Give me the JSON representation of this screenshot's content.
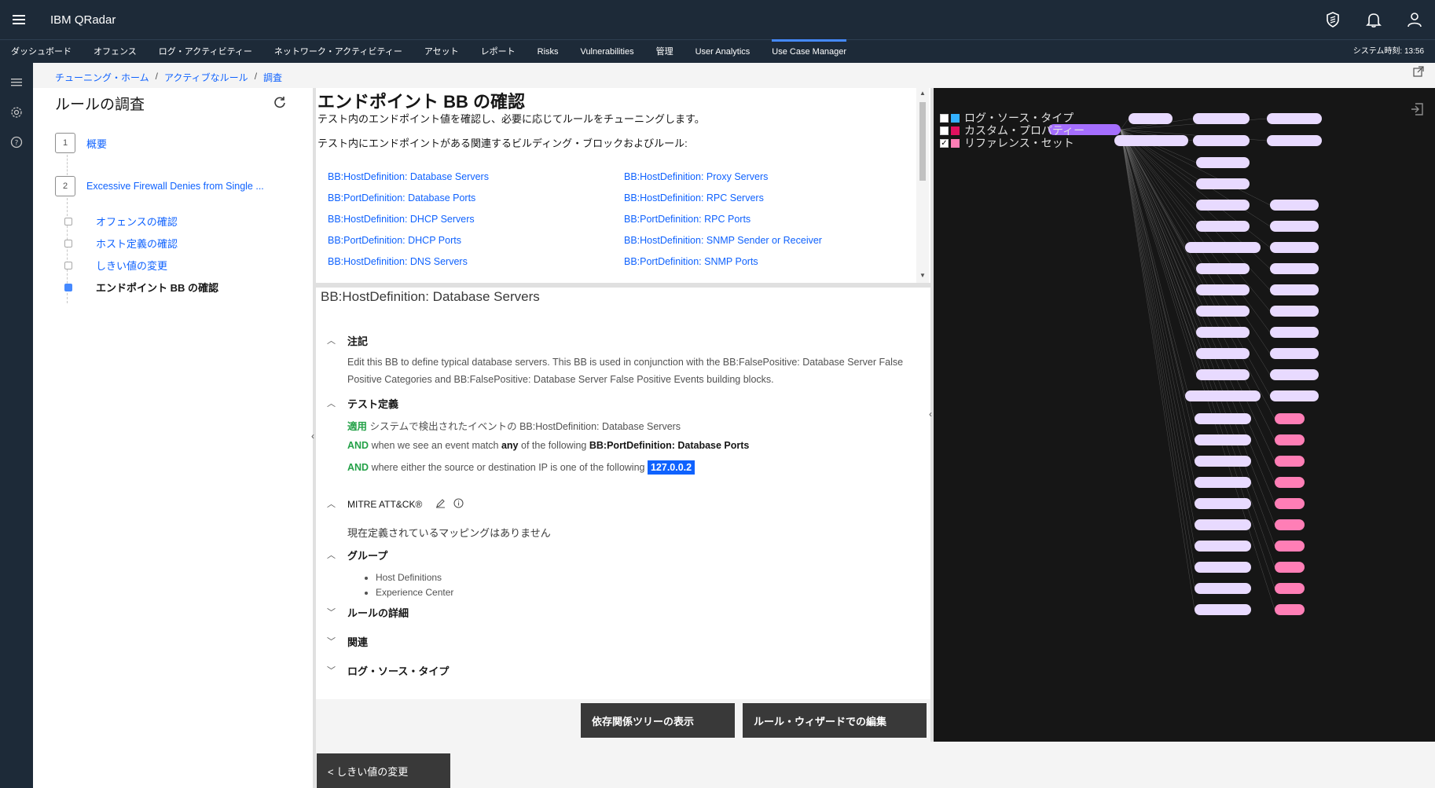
{
  "header": {
    "brand": "IBM QRadar"
  },
  "nav": {
    "items": [
      "ダッシュボード",
      "オフェンス",
      "ログ・アクティビティー",
      "ネットワーク・アクティビティー",
      "アセット",
      "レポート",
      "Risks",
      "Vulnerabilities",
      "管理",
      "User Analytics",
      "Use Case Manager"
    ],
    "active_index": 10,
    "time": "システム時刻: 13:56"
  },
  "breadcrumb": [
    "チューニング・ホーム",
    "アクティブなルール",
    "調査"
  ],
  "left": {
    "title": "ルールの調査",
    "steps": [
      {
        "num": "1",
        "label": "概要"
      },
      {
        "num": "2",
        "label": "Excessive Firewall Denies from Single ..."
      }
    ],
    "substeps": [
      {
        "label": "オフェンスの確認"
      },
      {
        "label": "ホスト定義の確認"
      },
      {
        "label": "しきい値の変更"
      },
      {
        "label": "エンドポイント BB の確認"
      }
    ]
  },
  "center_top": {
    "title": "エンドポイント BB の確認",
    "description": "テスト内のエンドポイント値を確認し、必要に応じてルールをチューニングします。",
    "subtitle": "テスト内にエンドポイントがある関連するビルディング・ブロックおよびルール:",
    "links": [
      "BB:HostDefinition: Database Servers",
      "BB:HostDefinition: Proxy Servers",
      "BB:PortDefinition: Database Ports",
      "BB:HostDefinition: RPC Servers",
      "BB:HostDefinition: DHCP Servers",
      "BB:PortDefinition: RPC Ports",
      "BB:PortDefinition: DHCP Ports",
      "BB:HostDefinition: SNMP Sender or Receiver",
      "BB:HostDefinition: DNS Servers",
      "BB:PortDefinition: SNMP Ports"
    ]
  },
  "details": {
    "title": "BB:HostDefinition: Database Servers",
    "notes_label": "注記",
    "notes_text": "Edit this BB to define typical database servers. This BB is used in conjunction with the BB:FalsePositive: Database Server False Positive Categories and BB:FalsePositive: Database Server False Positive Events building blocks.",
    "test_label": "テスト定義",
    "test1_kw": "適用",
    "test1_text": "システムで検出されたイベントの BB:HostDefinition: Database Servers",
    "test2_kw": "AND",
    "test2_a": "when we see an event match",
    "test2_b": "any",
    "test2_c": "of the following",
    "test2_d": "BB:PortDefinition: Database Ports",
    "test3_kw": "AND",
    "test3_text": "where either the source or destination IP is one of the following",
    "test3_ip": "127.0.0.2",
    "mitre_label": "MITRE ATT&CK®",
    "mitre_text": "現在定義されているマッピングはありません",
    "group_label": "グループ",
    "groups": [
      "Host Definitions",
      "Experience Center"
    ],
    "rule_details_label": "ルールの詳細",
    "related_label": "関連",
    "log_source_label": "ログ・ソース・タイプ"
  },
  "buttons": {
    "dependency_tree": "依存関係ツリーの表示",
    "edit_wizard": "ルール・ウィザードでの編集",
    "back": "< しきい値の変更"
  },
  "graph": {
    "legend": [
      {
        "label": "ログ・ソース・タイプ",
        "color": "#33b1ff",
        "checked": false
      },
      {
        "label": "カスタム・プロパティー",
        "color": "#e0115f",
        "checked": false
      },
      {
        "label": "リファレンス・セット",
        "color": "#ff7eb6",
        "checked": true
      }
    ],
    "colors": {
      "bb_node": "#e8daff",
      "rule_node": "#a56eff",
      "ref_node": "#ff7eb6",
      "edge": "#8d8d8d"
    }
  }
}
